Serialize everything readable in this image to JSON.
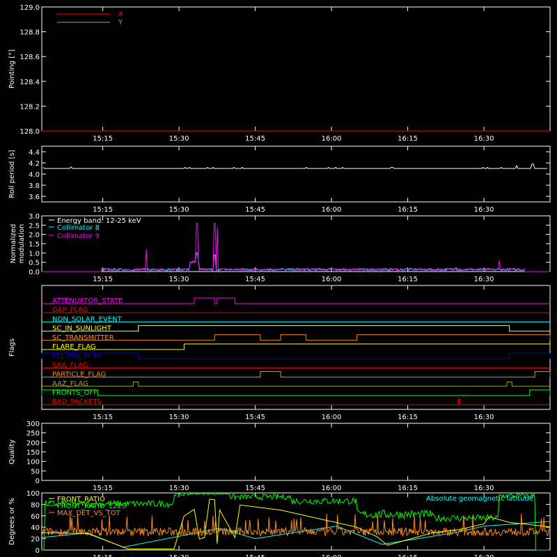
{
  "x_ticks": [
    "15:15",
    "15:30",
    "15:45",
    "16:00",
    "16:15",
    "16:30"
  ],
  "colors": {
    "axis": "#ffffff",
    "red": "#ff0000",
    "olive": "#a6a633",
    "cyan": "#00ffff",
    "magenta": "#ff00ff",
    "yellow": "#ffff00",
    "green": "#00ff00",
    "orange": "#ff8c1a",
    "blue": "#0000ff"
  },
  "chart_data": [
    {
      "type": "line",
      "ylabel": "Pointing [°]",
      "ylim": [
        128.0,
        129.0
      ],
      "yticks": [
        "128.0",
        "128.2",
        "128.4",
        "128.6",
        "128.8",
        "129.0"
      ],
      "series": [
        {
          "name": "X",
          "color": "red"
        },
        {
          "name": "Y",
          "color": "olive"
        }
      ],
      "note_y_value": 128.0
    },
    {
      "type": "line",
      "ylabel": "Roll period [s]",
      "ylim": [
        3.5,
        4.5
      ],
      "yticks": [
        "3.6",
        "3.8",
        "4.0",
        "4.2",
        "4.4"
      ],
      "series": [
        {
          "name": "",
          "color": "axis",
          "value": 4.1
        }
      ]
    },
    {
      "type": "line",
      "ylabel": "Normalized modulation",
      "ylabel_lines": [
        "Normalized",
        "modulation"
      ],
      "ylim": [
        0.0,
        3.0
      ],
      "yticks": [
        "0.0",
        "0.5",
        "1.0",
        "1.5",
        "2.0",
        "2.5",
        "3.0"
      ],
      "legend": {
        "energy_label": "Energy band: 12-25 keV",
        "items": [
          {
            "name": "Collimator 8",
            "color": "cyan"
          },
          {
            "name": "Collimator 9",
            "color": "magenta"
          }
        ]
      }
    },
    {
      "type": "line",
      "ylabel": "Flags",
      "flags": [
        {
          "name": "ATTENUATOR_STATE",
          "color": "magenta"
        },
        {
          "name": "GAP_FLAG",
          "color": "red"
        },
        {
          "name": "NON_SOLAR_EVENT",
          "color": "cyan"
        },
        {
          "name": "SC_IN_SUNLIGHT",
          "color": "yellow"
        },
        {
          "name": "SC_TRANSMITTER",
          "color": "orange"
        },
        {
          "name": "FLARE_FLAG",
          "color": "yellow"
        },
        {
          "name": "ECLIPSE_FLAG",
          "color": "blue"
        },
        {
          "name": "SAA_FLAG",
          "color": "red"
        },
        {
          "name": "PARTICLE_FLAG",
          "color": "orange"
        },
        {
          "name": "AAZ_FLAG",
          "color": "olive"
        },
        {
          "name": "FRONTS_OFF",
          "color": "green"
        },
        {
          "name": "BAD_PACKETS",
          "color": "red"
        }
      ]
    },
    {
      "type": "line",
      "ylabel": "Quality",
      "ylim": [
        0,
        300
      ],
      "yticks": [
        "0",
        "50",
        "100",
        "150",
        "200",
        "250",
        "300"
      ]
    },
    {
      "type": "line",
      "ylabel": "Degrees or %",
      "ylim": [
        0,
        100
      ],
      "yticks": [
        "0",
        "20",
        "40",
        "60",
        "80",
        "100"
      ],
      "series": [
        {
          "name": "FRONT_RATIO",
          "color": "yellow"
        },
        {
          "name": "FRONT_RATIO_1225",
          "color": "green"
        },
        {
          "name": "MAX_DET_VS_TOT",
          "color": "orange"
        },
        {
          "name": "Absolute geomagnetic latitude",
          "color": "cyan"
        }
      ]
    }
  ]
}
